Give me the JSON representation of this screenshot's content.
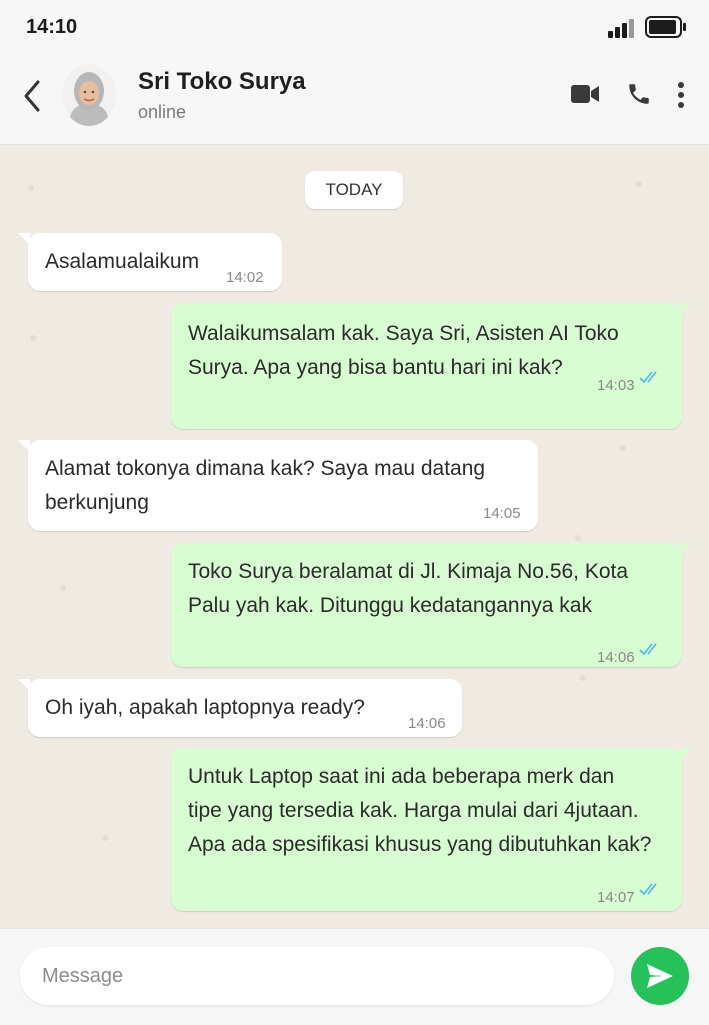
{
  "status_bar": {
    "time": "14:10"
  },
  "header": {
    "contact_name": "Sri Toko Surya",
    "status": "online"
  },
  "chat": {
    "day_label": "TODAY",
    "messages": [
      {
        "direction": "incoming",
        "lines": [
          "Asalamualaikum"
        ],
        "time": "14:02"
      },
      {
        "direction": "outgoing",
        "lines": [
          "Walaikumsalam kak. Saya Sri, Asisten AI Toko",
          "Surya. Apa yang bisa bantu hari ini kak?"
        ],
        "time": "14:03",
        "read": true
      },
      {
        "direction": "incoming",
        "lines": [
          "Alamat tokonya dimana kak? Saya mau datang",
          "berkunjung"
        ],
        "time": "14:05"
      },
      {
        "direction": "outgoing",
        "lines": [
          "Toko Surya beralamat di Jl. Kimaja No.56, Kota",
          "Palu yah kak. Ditunggu kedatangannya kak"
        ],
        "time": "14:06",
        "read": true
      },
      {
        "direction": "incoming",
        "lines": [
          "Oh iyah, apakah laptopnya ready?"
        ],
        "time": "14:06"
      },
      {
        "direction": "outgoing",
        "lines": [
          "Untuk Laptop saat ini ada beberapa merk dan",
          "tipe yang tersedia kak. Harga mulai dari 4jutaan.",
          "Apa ada spesifikasi khusus yang dibutuhkan kak?"
        ],
        "time": "14:07",
        "read": true
      }
    ]
  },
  "composer": {
    "placeholder": "Message"
  },
  "colors": {
    "outgoing_bubble": "#d9fdd3",
    "incoming_bubble": "#ffffff",
    "background": "#efeae2",
    "send_button": "#25c25a",
    "read_ticks": "#53bdeb"
  },
  "icons": [
    "back-arrow-icon",
    "video-call-icon",
    "phone-icon",
    "more-options-icon",
    "double-check-icon",
    "send-icon",
    "signal-icon",
    "battery-icon"
  ]
}
